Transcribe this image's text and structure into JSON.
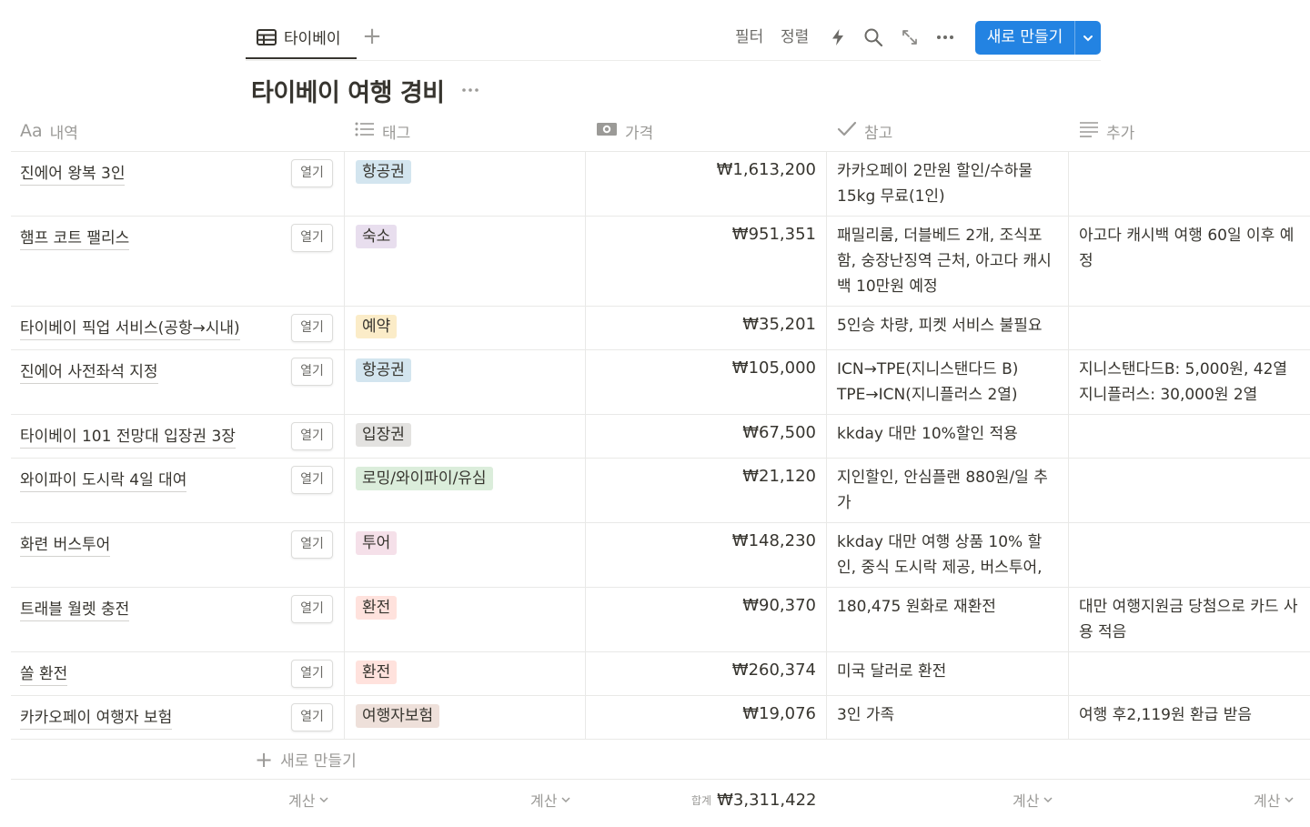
{
  "view_tab": {
    "label": "타이베이"
  },
  "toolbar": {
    "filter": "필터",
    "sort": "정렬",
    "new_button": "새로 만들기"
  },
  "database": {
    "title": "타이베이 여행 경비"
  },
  "columns": {
    "name": {
      "label": "내역",
      "prefix": "Aa"
    },
    "tag": {
      "label": "태그"
    },
    "price": {
      "label": "가격"
    },
    "note": {
      "label": "참고"
    },
    "extra": {
      "label": "추가"
    }
  },
  "open_label": "열기",
  "rows": [
    {
      "name": "진에어 왕복 3인",
      "tag": "항공권",
      "tag_color": "#d3e5ef",
      "price": "₩1,613,200",
      "note": "카카오페이 2만원 할인/수하물 15kg 무료(1인)",
      "extra": ""
    },
    {
      "name": "햄프 코트 팰리스",
      "tag": "숙소",
      "tag_color": "#e8deee",
      "price": "₩951,351",
      "note": "패밀리룸, 더블베드 2개, 조식포함, 숭장난징역 근처, 아고다 캐시백 10만원 예정",
      "extra": "아고다 캐시백 여행 60일 이후 예정"
    },
    {
      "name": "타이베이 픽업 서비스(공항→시내)",
      "tag": "예약",
      "tag_color": "#fbecc8",
      "price": "₩35,201",
      "note": "5인승 차량, 피켓 서비스 불필요",
      "extra": ""
    },
    {
      "name": "진에어 사전좌석 지정",
      "tag": "항공권",
      "tag_color": "#d3e5ef",
      "price": "₩105,000",
      "note": "ICN→TPE(지니스탠다드 B) TPE→ICN(지니플러스 2열)",
      "extra": "지니스탠다드B: 5,000원, 42열 지니플러스: 30,000원 2열"
    },
    {
      "name": "타이베이 101 전망대 입장권 3장",
      "tag": "입장권",
      "tag_color": "#e3e2e0",
      "price": "₩67,500",
      "note": "kkday 대만 10%할인 적용",
      "extra": ""
    },
    {
      "name": "와이파이 도시락 4일 대여",
      "tag": "로밍/와이파이/유심",
      "tag_color": "#dbeddb",
      "price": "₩21,120",
      "note": "지인할인, 안심플랜 880원/일 추가",
      "extra": ""
    },
    {
      "name": "화련 버스투어",
      "tag": "투어",
      "tag_color": "#f5e0e9",
      "price": "₩148,230",
      "note": "kkday 대만 여행 상품 10% 할인, 중식 도시락 제공, 버스투어,",
      "extra": ""
    },
    {
      "name": "트래블 월렛 충전",
      "tag": "환전",
      "tag_color": "#ffe2dd",
      "price": "₩90,370",
      "note": "180,475 원화로 재환전",
      "extra": "대만 여행지원금 당첨으로 카드 사용 적음"
    },
    {
      "name": "쏠 환전",
      "tag": "환전",
      "tag_color": "#ffe2dd",
      "price": "₩260,374",
      "note": "미국 달러로 환전",
      "extra": ""
    },
    {
      "name": "카카오페이 여행자 보험",
      "tag": "여행자보험",
      "tag_color": "#eee0da",
      "price": "₩19,076",
      "note": "3인 가족",
      "extra": "여행 후2,119원 환급 받음"
    }
  ],
  "add_row_label": "새로 만들기",
  "footer": {
    "calc_label": "계산",
    "sum_label": "합계",
    "sum_value": "₩3,311,422"
  },
  "icons": {
    "view": "table-icon",
    "add_view": "plus-icon",
    "automation": "lightning-icon",
    "search": "search-icon",
    "expand": "expand-icon",
    "more": "more-icon",
    "new_dropdown": "chevron-down-icon"
  },
  "colors": {
    "accent": "#2383e2"
  }
}
